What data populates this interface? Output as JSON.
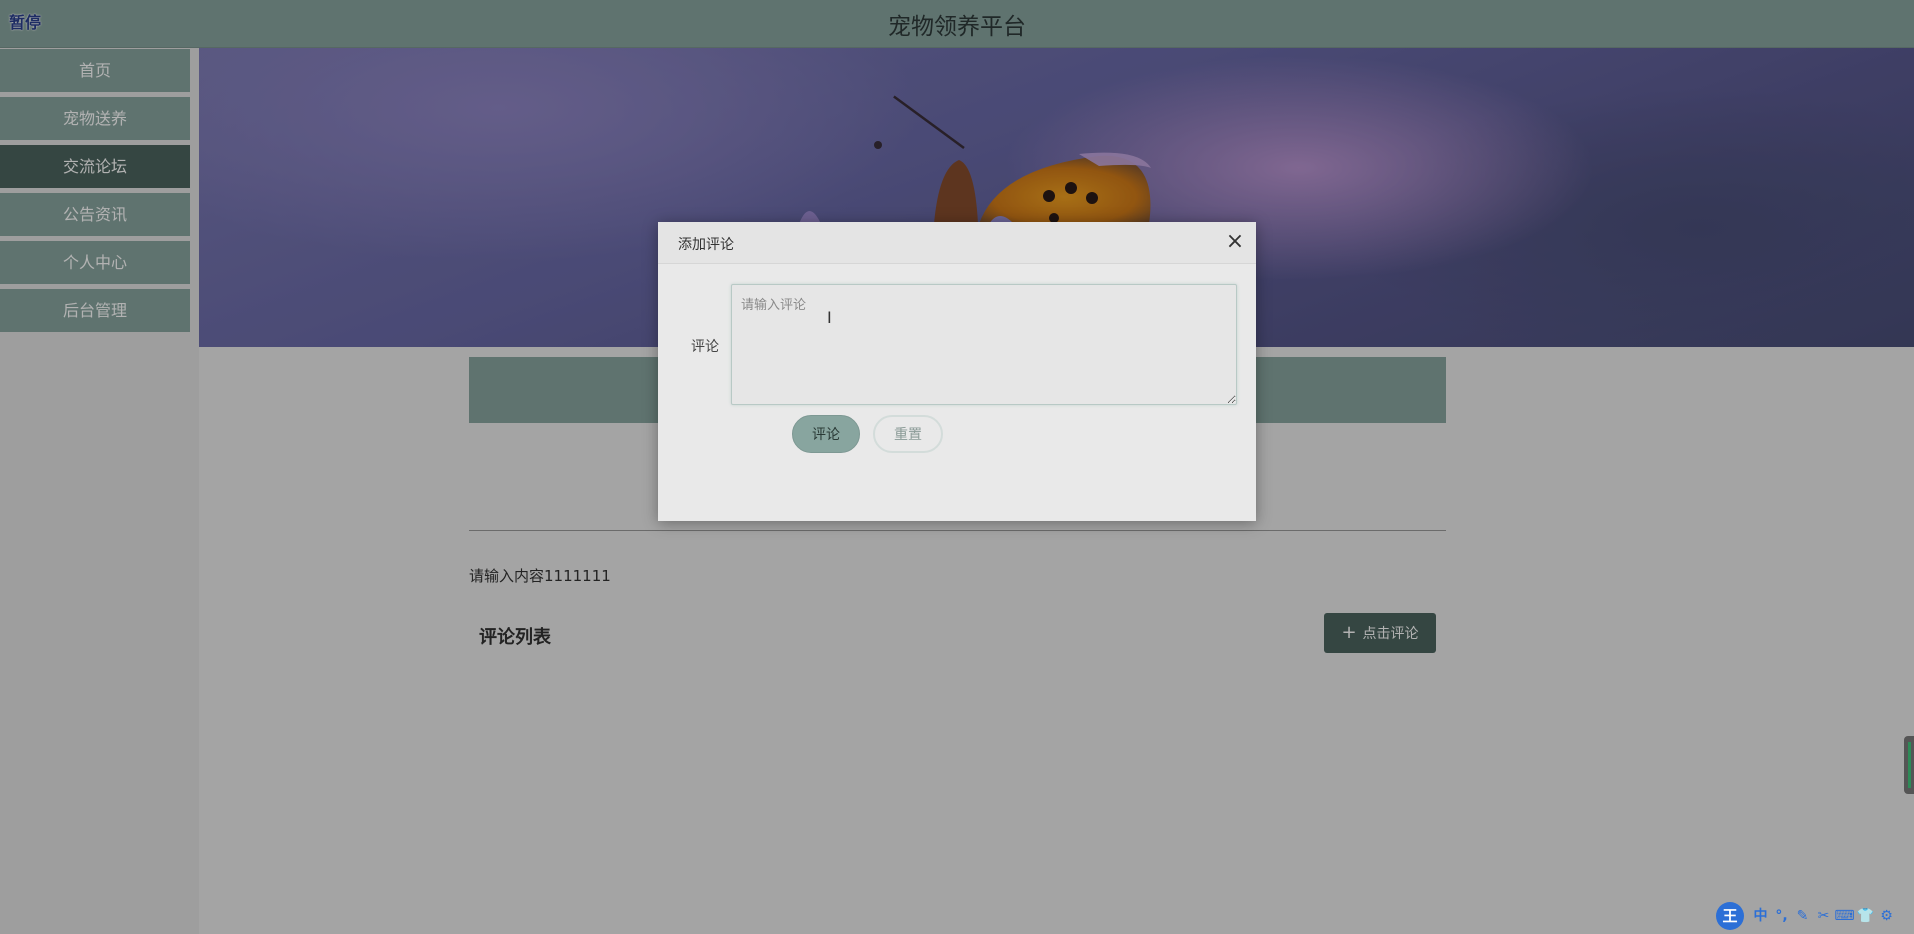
{
  "header": {
    "pause_label": "暂停",
    "title": "宠物领养平台"
  },
  "sidebar": {
    "items": [
      {
        "label": "首页",
        "active": false
      },
      {
        "label": "宠物送养",
        "active": false
      },
      {
        "label": "交流论坛",
        "active": true
      },
      {
        "label": "公告资讯",
        "active": false
      },
      {
        "label": "个人中心",
        "active": false
      },
      {
        "label": "后台管理",
        "active": false
      }
    ]
  },
  "post": {
    "content": "请输入内容1111111",
    "comments_title": "评论列表",
    "add_comment_label": "点击评论",
    "add_comment_icon": "plus-icon"
  },
  "dialog": {
    "title": "添加评论",
    "close_icon": "close-icon",
    "field_label": "评论",
    "field_value": "",
    "field_placeholder": "请输入评论",
    "submit_label": "评论",
    "reset_label": "重置"
  },
  "ime": {
    "logo": "王",
    "tools": [
      "中",
      "°,",
      "✎",
      "✂",
      "⌨",
      "👕",
      "⚙"
    ]
  },
  "colors": {
    "primary": "#88a59f",
    "primary_dark": "#4c655f",
    "sidebar_bg": "#e3e3e3",
    "page_bg": "#ebebeb",
    "ime_blue": "#2c6fd6"
  }
}
